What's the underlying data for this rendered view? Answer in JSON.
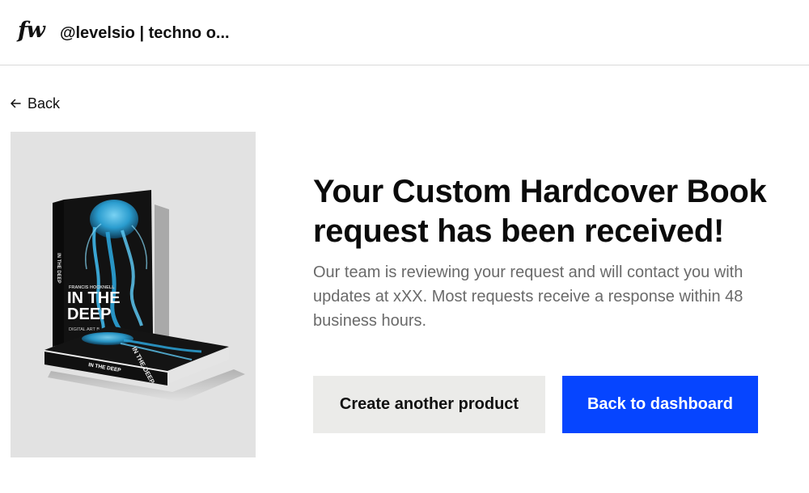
{
  "header": {
    "logo": "fw",
    "title": "@levelsio | techno o..."
  },
  "nav": {
    "back_label": "Back",
    "back_icon": "arrow-left-icon"
  },
  "product_image": {
    "book_spine_text": "IN THE DEEP",
    "book_title_line1": "IN THE",
    "book_title_line2": "DEEP",
    "book_author": "FRANCIS HOCKNELL",
    "book_subtitle": "DIGITAL ART B",
    "bottom_book_title": "IN THE DEEP",
    "bottom_book_cover_text": "IN THE DEEP",
    "colors": {
      "panel_bg": "#e2e2e2",
      "book_cover": "#121212",
      "jellyfish": "#3fb6e8"
    }
  },
  "confirmation": {
    "headline": "Your Custom Hardcover Book request has been received!",
    "message": "Our team is reviewing your request and will contact you with updates at xXX. Most requests receive a response within 48 business hours."
  },
  "actions": {
    "secondary_label": "Create another product",
    "primary_label": "Back to dashboard"
  },
  "colors": {
    "primary": "#0645ff",
    "secondary_bg": "#ebebe9",
    "text": "#111111",
    "muted_text": "#6a6a6a"
  }
}
